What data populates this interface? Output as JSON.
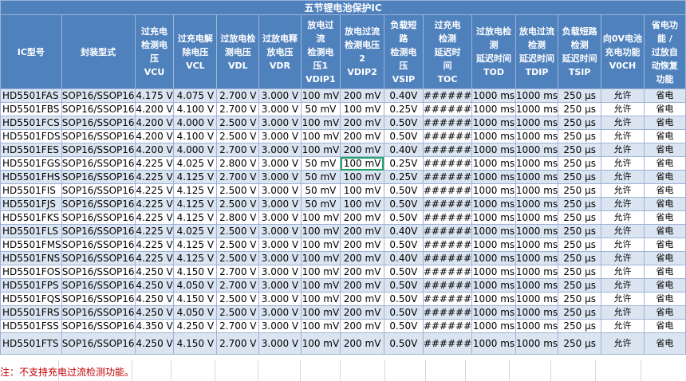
{
  "title": "五节锂电池保护IC",
  "headers": [
    "IC型号",
    "封装型式",
    "过充电检测电压VCU",
    "过充电解除电压VCL",
    "过放电检测电压VDL",
    "过放电释放电压VDR",
    "放电过流检测电压1VDIP1",
    "放电过流检测电压2VDIP2",
    "负载短路检测电压VSIP",
    "过充电检测延迟时间TOC",
    "过放电检测延迟时间TOD",
    "放电过流检测延迟时间TDIP",
    "负载短路检测延迟时间TSIP",
    "向0V电池充电功能V0CH",
    "省电功能/过放自动恢复功能"
  ],
  "header_lines": [
    [
      "IC型号"
    ],
    [
      "封装型式"
    ],
    [
      "过充电",
      "检测电",
      "压",
      "VCU"
    ],
    [
      "过充电解",
      "除电压",
      "VCL"
    ],
    [
      "过放电检",
      "测电压",
      "VDL"
    ],
    [
      "过放电释",
      "放电压",
      "VDR"
    ],
    [
      "放电过",
      "流",
      "检测电",
      "压1",
      "VDIP1"
    ],
    [
      "放电过流",
      "检测电压",
      "2",
      "VDIP2"
    ],
    [
      "负载短",
      "路",
      "检测电",
      "压",
      "VSIP"
    ],
    [
      "过充电",
      "检测",
      "延迟时",
      "间",
      "TOC"
    ],
    [
      "过放电检",
      "测",
      "延迟时间",
      "TOD"
    ],
    [
      "放电过流",
      "检测",
      "延迟时间",
      "TDIP"
    ],
    [
      "负载短路",
      "检测",
      "延迟时间",
      "TSIP"
    ],
    [
      "向0V电池",
      "充电功能",
      "V0CH"
    ],
    [
      "省电功",
      "能 /",
      "过放自",
      "动恢复",
      "功能"
    ]
  ],
  "rows": [
    [
      "HD5501FAS",
      "SOP16/SSOP16",
      "4.175 V",
      "4.075 V",
      "2.700 V",
      "3.000 V",
      "100 mV",
      "200 mV",
      "0.40V",
      "######",
      "1000 ms",
      "1000 ms",
      "250 μs",
      "允许",
      "省电"
    ],
    [
      "HD5501FBS",
      "SOP16/SSOP16",
      "4.200 V",
      "4.100 V",
      "2.700 V",
      "3.000 V",
      "50 mV",
      "100 mV",
      "0.25V",
      "######",
      "1000 ms",
      "1000 ms",
      "250 μs",
      "允许",
      "省电"
    ],
    [
      "HD5501FCS",
      "SOP16/SSOP16",
      "4.200 V",
      "4.000 V",
      "2.500 V",
      "3.000 V",
      "100 mV",
      "200 mV",
      "0.50V",
      "######",
      "1000 ms",
      "1000 ms",
      "250 μs",
      "允许",
      "省电"
    ],
    [
      "HD5501FDS",
      "SOP16/SSOP16",
      "4.200 V",
      "4.100 V",
      "2.500 V",
      "3.000 V",
      "100 mV",
      "200 mV",
      "0.50V",
      "######",
      "1000 ms",
      "1000 ms",
      "250 μs",
      "允许",
      "省电"
    ],
    [
      "HD5501FES",
      "SOP16/SSOP16",
      "4.200 V",
      "4.000 V",
      "2.700 V",
      "3.000 V",
      "100 mV",
      "200 mV",
      "0.40V",
      "######",
      "1000 ms",
      "1000 ms",
      "250 μs",
      "允许",
      "省电"
    ],
    [
      "HD5501FGS",
      "SOP16/SSOP16",
      "4.225 V",
      "4.025 V",
      "2.800 V",
      "3.000 V",
      "50 mV",
      "100 mV",
      "0.25V",
      "######",
      "1000 ms",
      "1000 ms",
      "250 μs",
      "允许",
      "省电"
    ],
    [
      "HD5501FHS",
      "SOP16/SSOP16",
      "4.225 V",
      "4.125 V",
      "2.700 V",
      "3.000 V",
      "50 mV",
      "100 mV",
      "0.25V",
      "######",
      "1000 ms",
      "1000 ms",
      "250 μs",
      "允许",
      "省电"
    ],
    [
      "HD5501FIS",
      "SOP16/SSOP16",
      "4.225 V",
      "4.125 V",
      "2.500 V",
      "3.000 V",
      "50 mV",
      "100 mV",
      "0.50V",
      "######",
      "1000 ms",
      "1000 ms",
      "250 μs",
      "允许",
      "省电"
    ],
    [
      "HD5501FJS",
      "SOP16/SSOP16",
      "4.225 V",
      "4.125 V",
      "2.500 V",
      "3.000 V",
      "50 mV",
      "100 mV",
      "0.50V",
      "######",
      "1000 ms",
      "1000 ms",
      "250 μs",
      "允许",
      "省电"
    ],
    [
      "HD5501FKS",
      "SOP16/SSOP16",
      "4.225 V",
      "4.125 V",
      "2.800 V",
      "3.000 V",
      "100 mV",
      "200 mV",
      "0.50V",
      "######",
      "1000 ms",
      "1000 ms",
      "250 μs",
      "允许",
      "省电"
    ],
    [
      "HD5501FLS",
      "SOP16/SSOP16",
      "4.225 V",
      "4.025 V",
      "2.500 V",
      "3.000 V",
      "100 mV",
      "200 mV",
      "0.40V",
      "######",
      "1000 ms",
      "1000 ms",
      "250 μs",
      "允许",
      "省电"
    ],
    [
      "HD5501FMS",
      "SOP16/SSOP16",
      "4.225 V",
      "4.125 V",
      "2.500 V",
      "3.000 V",
      "100 mV",
      "200 mV",
      "0.50V",
      "######",
      "1000 ms",
      "1000 ms",
      "250 μs",
      "允许",
      "省电"
    ],
    [
      "HD5501FNS",
      "SOP16/SSOP16",
      "4.225 V",
      "4.125 V",
      "2.500 V",
      "3.000 V",
      "100 mV",
      "200 mV",
      "0.40V",
      "######",
      "1000 ms",
      "1000 ms",
      "250 μs",
      "允许",
      "省电"
    ],
    [
      "HD5501FOS",
      "SOP16/SSOP16",
      "4.250 V",
      "4.150 V",
      "2.700 V",
      "3.000 V",
      "100 mV",
      "200 mV",
      "0.50V",
      "######",
      "1000 ms",
      "1000 ms",
      "250 μs",
      "允许",
      "省电"
    ],
    [
      "HD5501FPS",
      "SOP16/SSOP16",
      "4.250 V",
      "4.050 V",
      "2.700 V",
      "3.000 V",
      "100 mV",
      "200 mV",
      "0.50V",
      "######",
      "1000 ms",
      "1000 ms",
      "250 μs",
      "允许",
      "省电"
    ],
    [
      "HD5501FQS",
      "SOP16/SSOP16",
      "4.250 V",
      "4.150 V",
      "2.500 V",
      "3.000 V",
      "100 mV",
      "200 mV",
      "0.50V",
      "######",
      "1000 ms",
      "1000 ms",
      "250 μs",
      "允许",
      "省电"
    ],
    [
      "HD5501FRS",
      "SOP16/SSOP16",
      "4.250 V",
      "4.050 V",
      "2.500 V",
      "3.000 V",
      "100 mV",
      "200 mV",
      "0.50V",
      "######",
      "1000 ms",
      "1000 ms",
      "250 μs",
      "允许",
      "省电"
    ],
    [
      "HD5501FSS",
      "SOP16/SSOP16",
      "4.350 V",
      "4.250 V",
      "2.700 V",
      "3.000 V",
      "100 mV",
      "200 mV",
      "0.50V",
      "######",
      "1000 ms",
      "1000 ms",
      "250 μs",
      "允许",
      "省电"
    ],
    [
      "HD5501FTS",
      "SOP16/SSOP16",
      "4.250 V",
      "4.150 V",
      "2.700 V",
      "3.000 V",
      "100 mV",
      "200 mV",
      "0.50V",
      "######",
      "1000 ms",
      "1000 ms",
      "250 μs",
      "允许",
      "省电"
    ]
  ],
  "selected_cell": {
    "row": 5,
    "col": 7
  },
  "note": "注：不支持充电过流检测功能。",
  "colors": {
    "header_bg": "#4f81bd",
    "band": "#dbe5f1",
    "note": "#c00000",
    "selection": "#21a366"
  }
}
